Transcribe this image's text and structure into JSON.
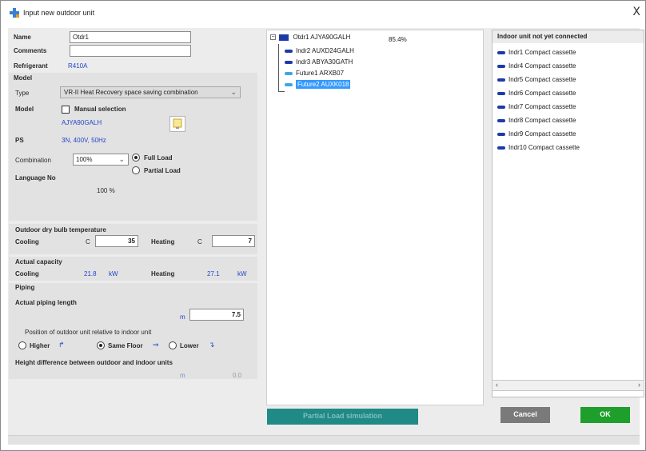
{
  "window": {
    "title": "Input new outdoor unit",
    "close_label": "X"
  },
  "form": {
    "name_label": "Name",
    "name_value": "Otdr1",
    "comments_label": "Comments",
    "comments_value": "",
    "refrigerant_label": "Refrigerant",
    "refrigerant_value": "R410A",
    "model_section": "Model",
    "type_label": "Type",
    "type_value": "VR-II Heat Recovery space saving combination",
    "model_label": "Model",
    "manual_selection_label": "Manual selection",
    "model_value": "AJYA90GALH",
    "ps_label": "PS",
    "ps_value": "3N, 400V, 50Hz",
    "combination_label": "Combination",
    "combination_value": "100%",
    "full_load_label": "Full Load",
    "partial_load_label": "Partial Load",
    "language_label": "Language No",
    "language_value": "100 %",
    "outdoor_temp_section": "Outdoor dry bulb temperature",
    "cooling_label": "Cooling",
    "cooling_unit": "C",
    "cooling_value": "35",
    "heating_label": "Heating",
    "heating_unit": "C",
    "heating_value": "7",
    "actual_capacity_section": "Actual capacity",
    "cap_cooling_label": "Cooling",
    "cap_cooling_value": "21.8",
    "cap_cooling_unit": "kW",
    "cap_heating_label": "Heating",
    "cap_heating_value": "27.1",
    "cap_heating_unit": "kW",
    "piping_section": "Piping",
    "piping_length_label": "Actual piping length",
    "piping_length_unit": "m",
    "piping_length_value": "7.5",
    "position_label": "Position of outdoor unit relative to indoor unit",
    "higher_label": "Higher",
    "same_floor_label": "Same Floor",
    "lower_label": "Lower",
    "height_diff_label": "Height difference between outdoor and indoor units",
    "height_diff_unit": "m",
    "height_diff_value": "0.0"
  },
  "tree": {
    "root": "Otdr1  AJYA90GALH",
    "root_pct": "85.4%",
    "children": [
      "Indr2  AUXD24GALH",
      "Indr3  ABYA30GATH",
      "Future1  ARXB07",
      "Future2  AUXK018"
    ]
  },
  "right": {
    "header": "Indoor unit not yet connected",
    "items": [
      "Indr1  Compact cassette",
      "Indr4  Compact cassette",
      "Indr5  Compact cassette",
      "Indr6  Compact cassette",
      "Indr7  Compact cassette",
      "Indr8  Compact cassette",
      "Indr9  Compact cassette",
      "Indr10  Compact cassette"
    ]
  },
  "buttons": {
    "partial_load": "Partial Load simulation",
    "cancel": "Cancel",
    "ok": "OK"
  },
  "colors": {
    "accent_blue": "#2244cc",
    "ok_green": "#1e9e2a",
    "partial_teal": "#1f8a86",
    "cancel_gray": "#7a7a7a",
    "selection": "#3399ff"
  }
}
